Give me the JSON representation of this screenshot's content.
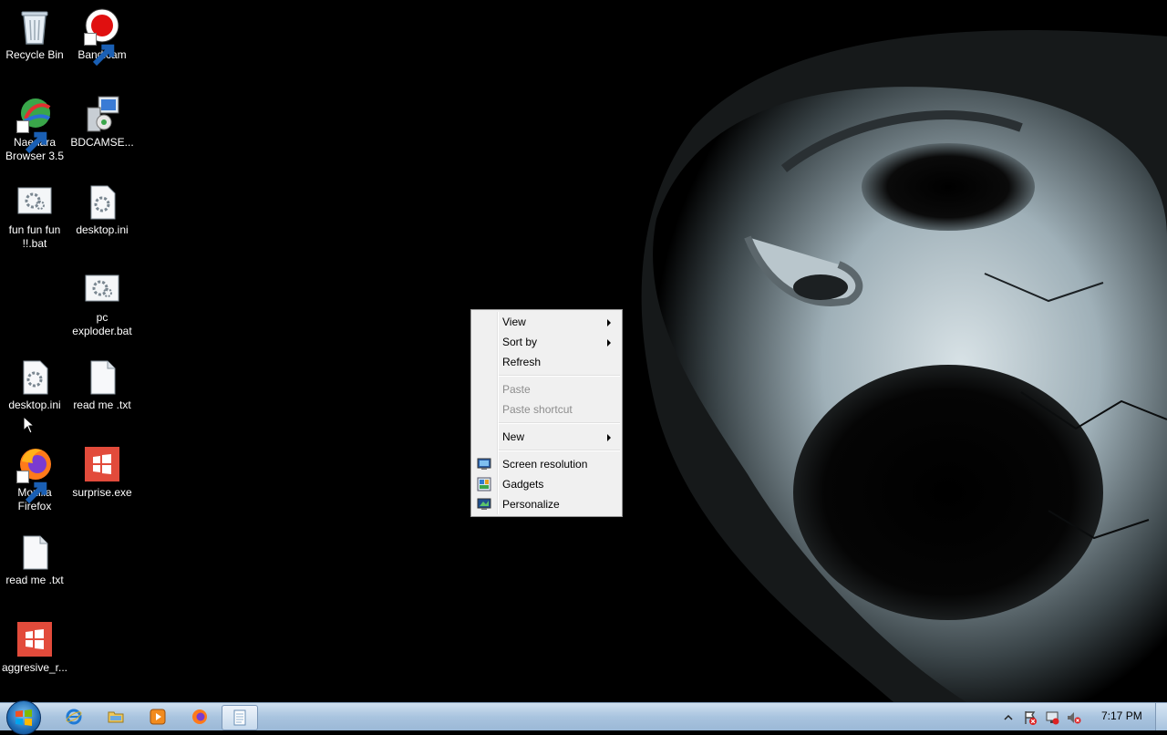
{
  "desktop": {
    "icons": [
      {
        "label": "Recycle Bin",
        "icon": "recycle-bin-icon"
      },
      {
        "label": "Bandicam",
        "icon": "bandicam-icon"
      },
      {
        "label": "Naenara Browser 3.5",
        "icon": "naenara-browser-icon"
      },
      {
        "label": "BDCAMSE...",
        "icon": "installer-icon"
      },
      {
        "label": "fun fun fun !!.bat",
        "icon": "batch-file-icon"
      },
      {
        "label": "desktop.ini",
        "icon": "settings-file-icon"
      },
      {
        "label": "pc exploder.bat",
        "icon": "batch-file-icon"
      },
      {
        "label": "desktop.ini",
        "icon": "settings-file-icon"
      },
      {
        "label": "read me .txt",
        "icon": "text-file-icon"
      },
      {
        "label": "Mozilla Firefox",
        "icon": "firefox-icon"
      },
      {
        "label": "surprise.exe",
        "icon": "windows-exe-icon"
      },
      {
        "label": "read me .txt",
        "icon": "text-file-icon"
      },
      {
        "label": "aggresive_r...",
        "icon": "windows-exe-icon"
      }
    ]
  },
  "context_menu": {
    "items": [
      {
        "label": "View",
        "has_submenu": true,
        "enabled": true
      },
      {
        "label": "Sort by",
        "has_submenu": true,
        "enabled": true
      },
      {
        "label": "Refresh",
        "has_submenu": false,
        "enabled": true
      },
      {
        "label": "Paste",
        "has_submenu": false,
        "enabled": false
      },
      {
        "label": "Paste shortcut",
        "has_submenu": false,
        "enabled": false
      },
      {
        "label": "New",
        "has_submenu": true,
        "enabled": true
      },
      {
        "label": "Screen resolution",
        "has_submenu": false,
        "enabled": true,
        "icon": "screen-resolution-icon"
      },
      {
        "label": "Gadgets",
        "has_submenu": false,
        "enabled": true,
        "icon": "gadgets-icon"
      },
      {
        "label": "Personalize",
        "has_submenu": false,
        "enabled": true,
        "icon": "personalize-icon"
      }
    ]
  },
  "taskbar": {
    "pinned": [
      "internet-explorer-icon",
      "windows-explorer-icon",
      "media-player-icon",
      "firefox-icon",
      "notepad-icon"
    ],
    "active_app": "notepad-icon",
    "tray_icons": [
      "show-hidden-icons-icon",
      "action-center-icon",
      "network-icon",
      "volume-muted-icon"
    ],
    "clock": "7:17 PM"
  },
  "colors": {
    "taskbar": "#a9c4df",
    "menu_background": "#f0f0f0",
    "exe_icon": "#e24b3b"
  }
}
